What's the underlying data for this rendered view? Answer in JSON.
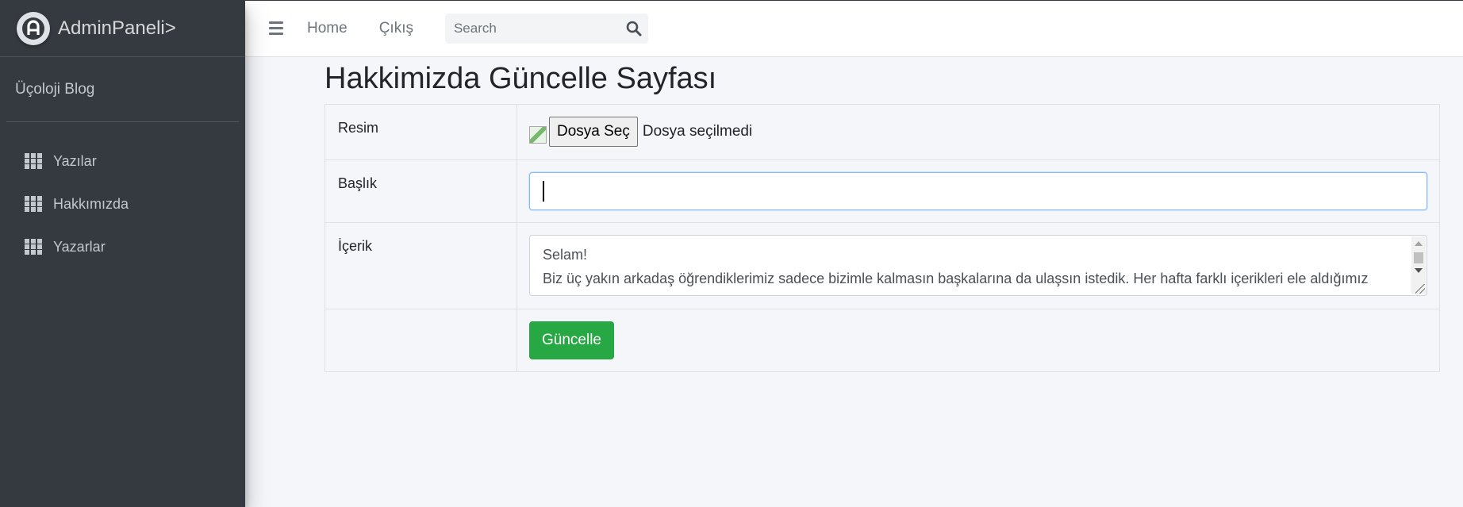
{
  "brand": {
    "name": "AdminPaneli>"
  },
  "sidebar": {
    "user": "Üçoloji Blog",
    "items": [
      {
        "label": "Yazılar",
        "icon": "th-grid-icon"
      },
      {
        "label": "Hakkımızda",
        "icon": "th-grid-icon"
      },
      {
        "label": "Yazarlar",
        "icon": "th-grid-icon"
      }
    ]
  },
  "navbar": {
    "home": "Home",
    "exit": "Çıkış",
    "search_placeholder": "Search",
    "search_value": ""
  },
  "page": {
    "title": "Hakkimizda Güncelle Sayfası"
  },
  "form": {
    "image_label": "Resim",
    "file_button": "Dosya Seç",
    "file_status": "Dosya seçilmedi",
    "title_label": "Başlık",
    "title_value": "",
    "content_label": "İçerik",
    "content_lines": [
      "Selam!",
      "Biz üç yakın arkadaş öğrendiklerimiz sadece bizimle kalmasın başkalarına da ulaşsın istedik. Her hafta farklı içerikleri ele aldığımız"
    ],
    "submit": "Güncelle"
  },
  "colors": {
    "sidebar_bg": "#343a40",
    "accent_success": "#28a745",
    "focus_border": "#80bdff"
  }
}
